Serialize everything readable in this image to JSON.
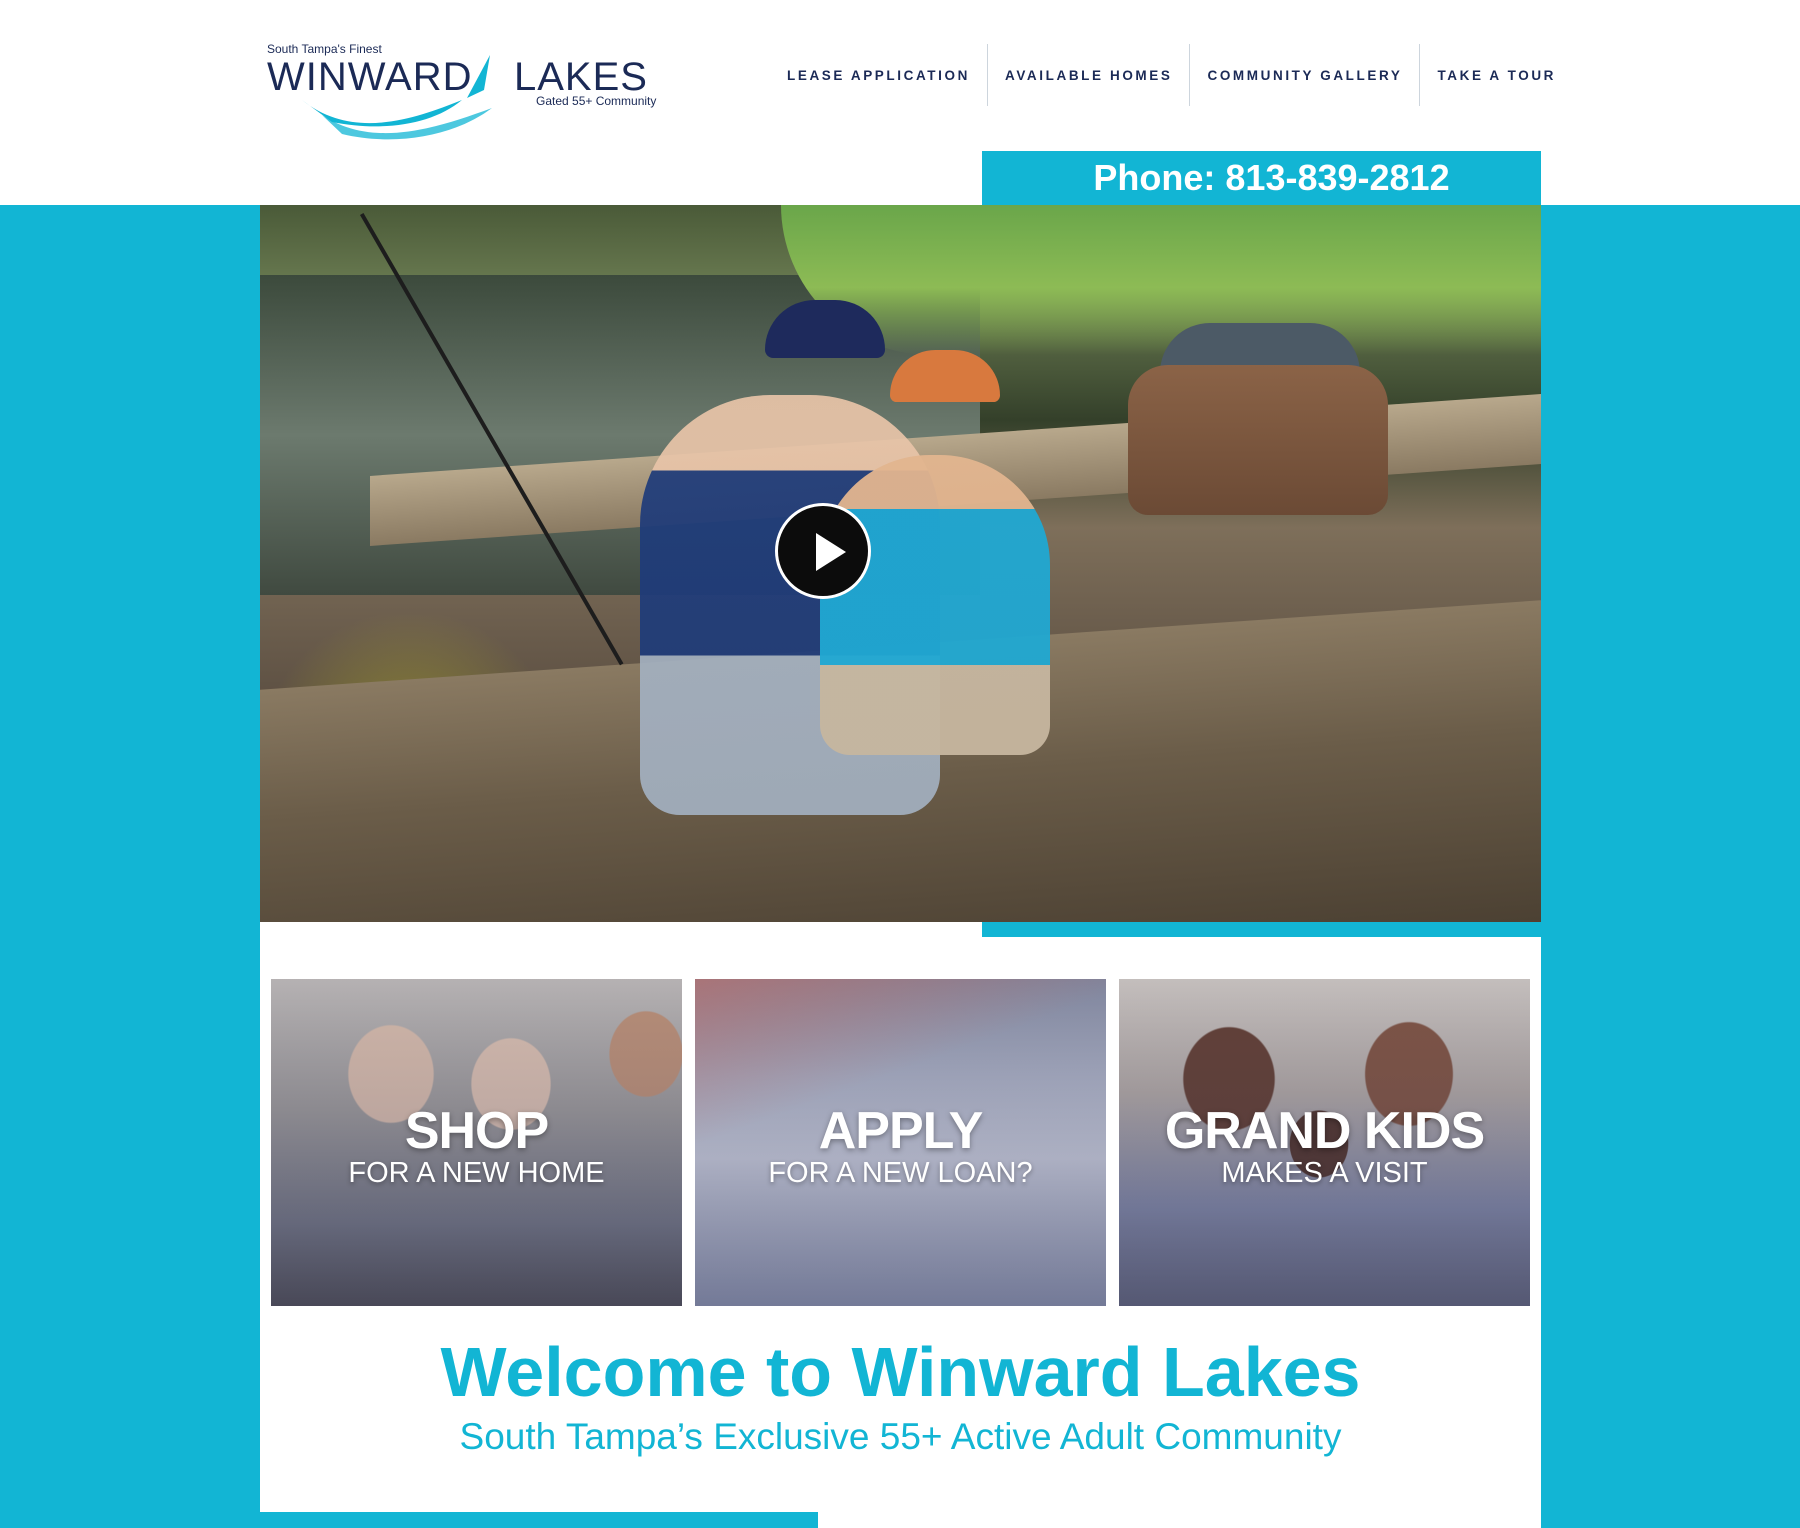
{
  "logo": {
    "tagline": "South Tampa's Finest",
    "name_part1": "WINWARD",
    "name_part2": "LAKES",
    "subtitle": "Gated 55+ Community"
  },
  "nav": [
    {
      "label": "LEASE APPLICATION"
    },
    {
      "label": "AVAILABLE HOMES"
    },
    {
      "label": "COMMUNITY GALLERY"
    },
    {
      "label": "TAKE A TOUR"
    }
  ],
  "phone": "Phone: 813-839-2812",
  "cards": [
    {
      "title": "SHOP",
      "subtitle": "FOR A NEW HOME"
    },
    {
      "title": "APPLY",
      "subtitle": "FOR A NEW LOAN?"
    },
    {
      "title": "GRAND KIDS",
      "subtitle": "MAKES A VISIT"
    }
  ],
  "welcome": {
    "title": "Welcome to Winward Lakes",
    "subtitle": "South Tampa’s Exclusive 55+ Active Adult Community"
  },
  "colors": {
    "accent": "#12b5d4",
    "navy": "#1b2a56"
  },
  "icons": {
    "play": "play-icon"
  }
}
